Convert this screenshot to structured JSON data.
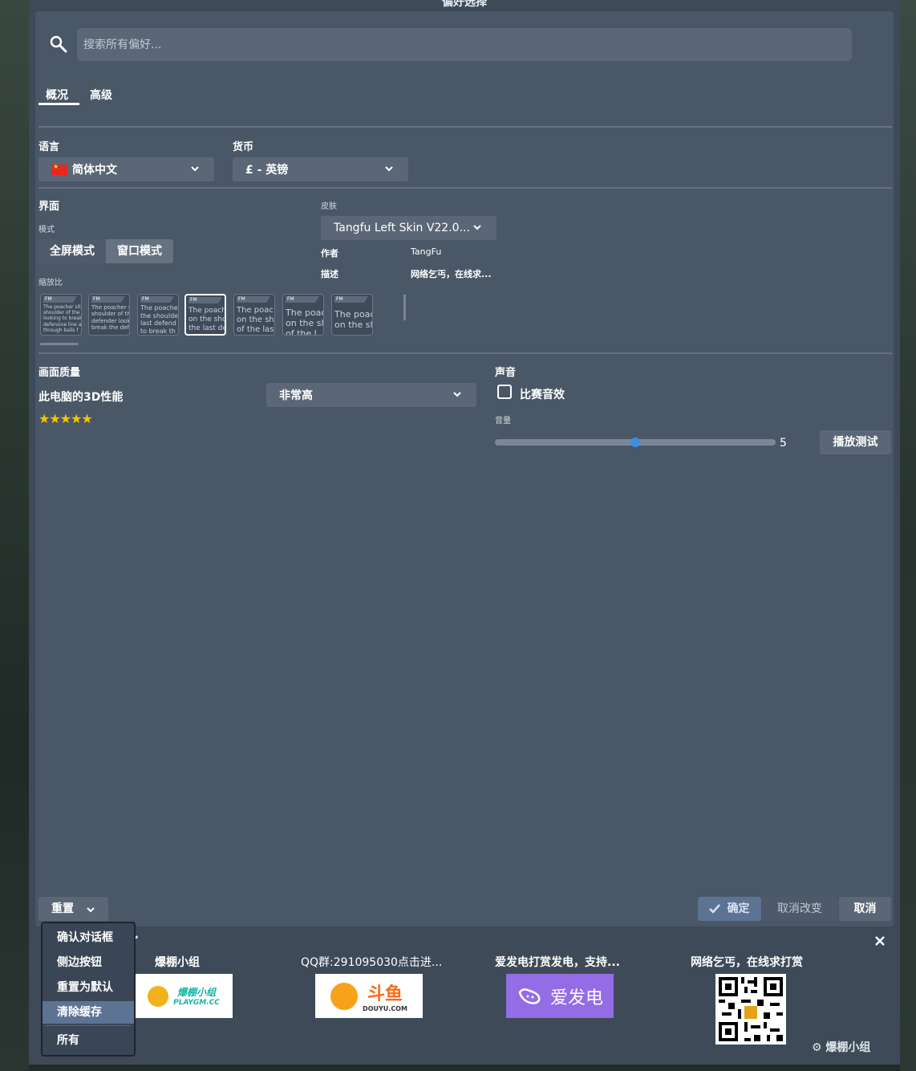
{
  "dialog": {
    "title": "偏好选择"
  },
  "search": {
    "placeholder": "搜索所有偏好..."
  },
  "tabs": [
    {
      "label": "概况"
    },
    {
      "label": "高级"
    }
  ],
  "language": {
    "label": "语言",
    "value": "简体中文"
  },
  "currency": {
    "label": "货币",
    "value": "£ - 英镑"
  },
  "interface": {
    "label": "界面",
    "mode_label": "模式",
    "modes": [
      "全屏模式",
      "窗口模式"
    ],
    "selected_mode": "窗口模式",
    "scale_label": "缩放比",
    "thumbnails": [
      {
        "badge": "FM",
        "text": "The poacher sits\nshoulder of the l\nlooking to break\ndefensive line ar\nthrough balls f"
      },
      {
        "badge": "FM",
        "text": "The poacher s\nshoulder of th\ndefender look\nbreak the def"
      },
      {
        "badge": "FM",
        "text": "The poache\nthe shoulde\nlast defend\nto break th"
      },
      {
        "badge": "FM",
        "text": "The poach\non the sho\nthe last de"
      },
      {
        "badge": "FM",
        "text": "The poac\non the sh\nof the las"
      },
      {
        "badge": "FM",
        "text": "The poac\non the sh\nof the l"
      },
      {
        "badge": "FM",
        "text": "The poac\non the sh"
      }
    ]
  },
  "skin": {
    "label": "皮肤",
    "value": "Tangfu Left Skin V22.0...",
    "author_label": "作者",
    "author": "TangFu",
    "desc_label": "描述",
    "desc": "网络乞丐，在线求..."
  },
  "graphics": {
    "label": "画面质量",
    "perf_label": "此电脑的3D性能",
    "stars": "★★★★★",
    "stars_value": 5,
    "quality": "非常高"
  },
  "sound": {
    "label": "声音",
    "match_sfx": "比赛音效",
    "match_sfx_checked": false,
    "volume_label": "音量",
    "volume": 5,
    "volume_max": 10,
    "test_button": "播放测试"
  },
  "footer": {
    "reset": "重置",
    "ok": "确定",
    "discard": "取消改变",
    "cancel": "取消"
  },
  "reset_menu": [
    "确认对话框",
    "侧边按钮",
    "重置为默认",
    "清除缓存",
    "所有"
  ],
  "reset_menu_selected": "清除缓存",
  "sponsors": [
    {
      "title": "爆棚小组",
      "logo_text": "爆棚小组",
      "logo_sub": "PLAYGM.CC"
    },
    {
      "title": "QQ群:291095030点击进...",
      "logo_text": "斗鱼",
      "logo_sub": "DOUYU.COM"
    },
    {
      "title": "爱发电打赏发电，支持...",
      "logo_text": "爱发电"
    },
    {
      "title": "网络乞丐，在线求打赏"
    }
  ],
  "colors": {
    "panel": "#4a5767",
    "dialog": "#3e4a58",
    "accent": "#3d8fe0",
    "ok_button": "#5d7394",
    "afdian": "#946ce6"
  }
}
